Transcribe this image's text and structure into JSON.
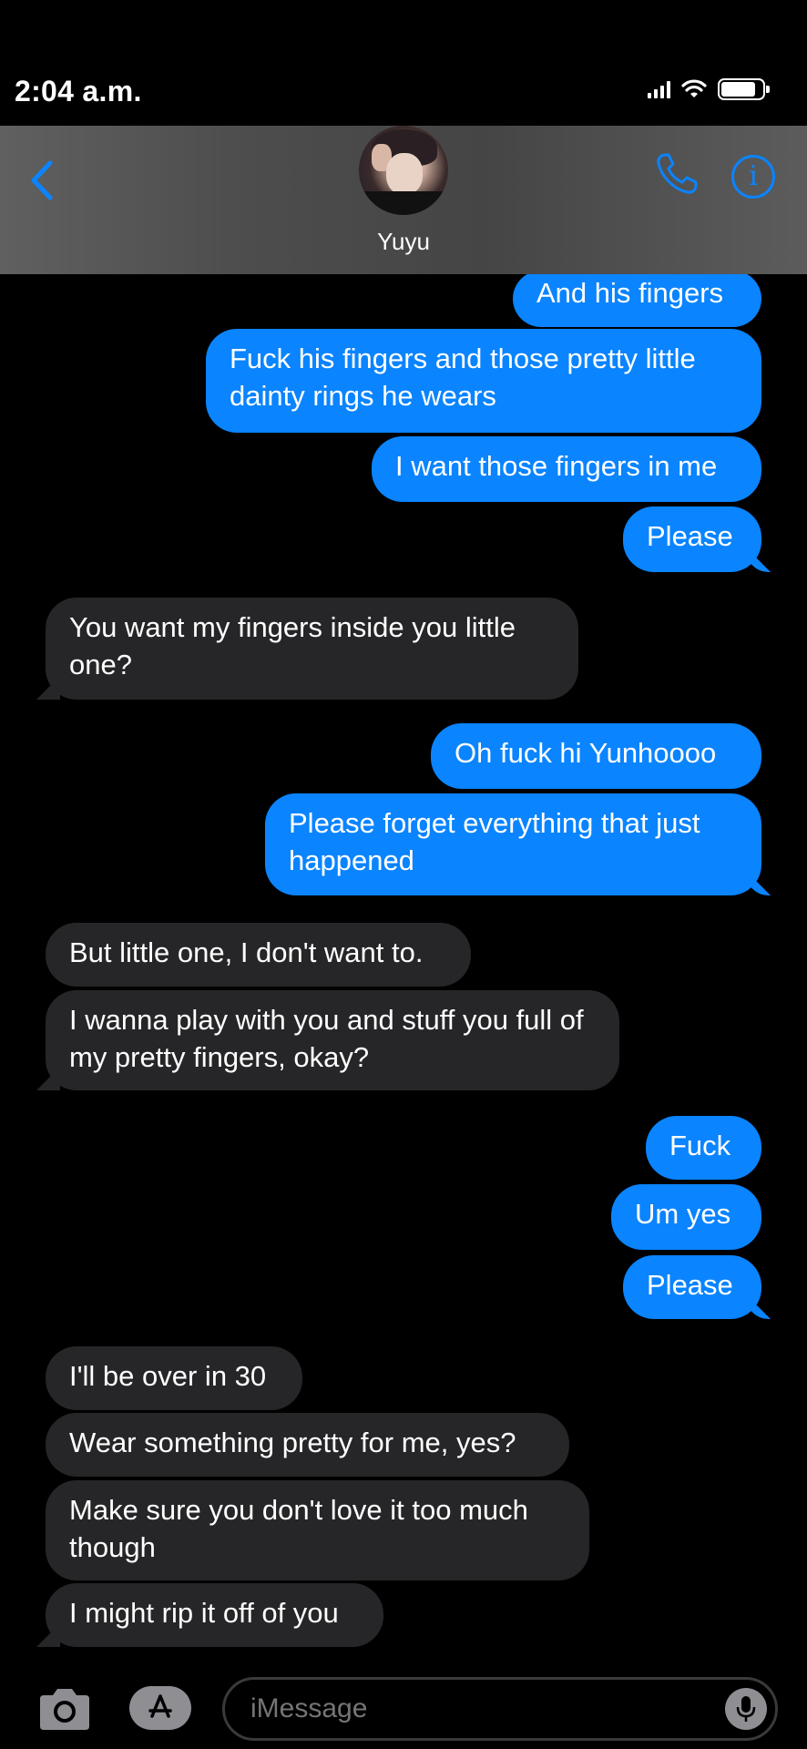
{
  "status_bar": {
    "time": "2:04 a.m.",
    "battery_level": 0.85
  },
  "header": {
    "contact_name": "Yuyu",
    "icons": [
      "back-chevron-icon",
      "phone-icon",
      "info-icon"
    ]
  },
  "colors": {
    "sent_bubble": "#0a84ff",
    "received_bubble": "#262628",
    "accent": "#0a84ff"
  },
  "messages": [
    {
      "dir": "sent",
      "text": "And his fingers"
    },
    {
      "dir": "sent",
      "text": "Fuck his fingers and those pretty little dainty rings he wears"
    },
    {
      "dir": "sent",
      "text": "I want those fingers in me"
    },
    {
      "dir": "sent",
      "text": "Please"
    },
    {
      "dir": "recv",
      "text": "You want my fingers inside you little one?"
    },
    {
      "dir": "sent",
      "text": "Oh fuck hi Yunhoooo"
    },
    {
      "dir": "sent",
      "text": "Please forget everything that just happened"
    },
    {
      "dir": "recv",
      "text": "But little one, I don't want to."
    },
    {
      "dir": "recv",
      "text": "I wanna play with you and stuff you full of my pretty fingers, okay?"
    },
    {
      "dir": "sent",
      "text": "Fuck"
    },
    {
      "dir": "sent",
      "text": "Um yes"
    },
    {
      "dir": "sent",
      "text": "Please"
    },
    {
      "dir": "recv",
      "text": "I'll be over in 30"
    },
    {
      "dir": "recv",
      "text": "Wear something pretty for me, yes?"
    },
    {
      "dir": "recv",
      "text": "Make sure you don't love it too much though"
    },
    {
      "dir": "recv",
      "text": "I might rip it off of you"
    }
  ],
  "input_bar": {
    "placeholder": "iMessage",
    "icons": [
      "camera-icon",
      "app-store-icon",
      "microphone-icon"
    ]
  }
}
